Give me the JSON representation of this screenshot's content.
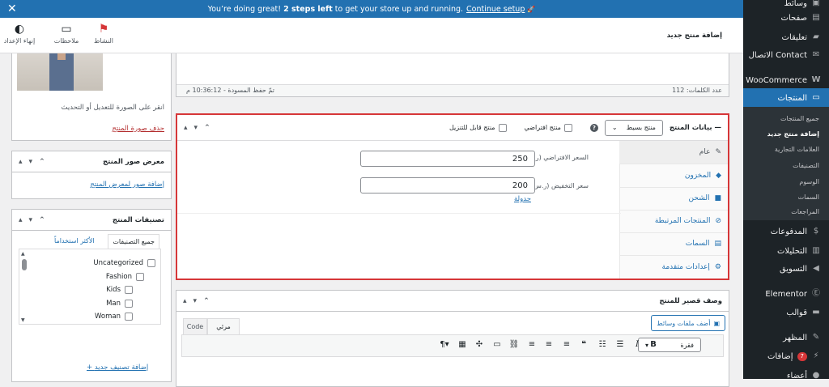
{
  "notice": {
    "text_before": "You’re doing great!",
    "text_bold": "2 steps left",
    "text_after": "to get your store up and running.",
    "link": "Continue setup",
    "rocket": "🚀"
  },
  "header": {
    "title": "إضافة منتج جديد",
    "buttons": [
      {
        "label": "النشاط",
        "icon": "flag-icon"
      },
      {
        "label": "ملاحظات",
        "icon": "inbox-icon"
      },
      {
        "label": "إنهاء الإعداد",
        "icon": "progress-circle-icon"
      }
    ]
  },
  "menu": {
    "items": [
      {
        "label": "وسائط",
        "icon": "media-icon"
      },
      {
        "label": "صفحات",
        "icon": "page-icon"
      },
      {
        "label": "تعليقات",
        "icon": "comment-icon"
      },
      {
        "label": "الاتصال Contact",
        "icon": "mail-icon"
      },
      {
        "label": "WooCommerce",
        "icon": "woo-icon"
      },
      {
        "label": "المنتجات",
        "icon": "archive-icon"
      },
      {
        "label": "المدفوعات",
        "icon": "dollar-icon"
      },
      {
        "label": "التحليلات",
        "icon": "bar-chart-icon"
      },
      {
        "label": "التسويق",
        "icon": "megaphone-icon"
      },
      {
        "label": "Elementor",
        "icon": "elementor-icon"
      },
      {
        "label": "قوالب",
        "icon": "folder-icon"
      },
      {
        "label": "المظهر",
        "icon": "brush-icon"
      },
      {
        "label": "إضافات",
        "icon": "plugin-icon",
        "badge": "7"
      },
      {
        "label": "أعضاء",
        "icon": "users-icon"
      }
    ],
    "submenu": [
      "جميع المنتجات",
      "إضافة منتج جديد",
      "العلامات التجارية",
      "التصنيفات",
      "الوسوم",
      "السمات",
      "المراجعات"
    ]
  },
  "editor_status": {
    "word_count": "عدد الكلمات: 112",
    "draft_saved": "تمّ حفظ المسودة - 10:36:12 م"
  },
  "product_data": {
    "title": "بيانات المنتج —",
    "type_select": "منتج بسيط",
    "help_icon": "?",
    "virtual_label": "منتج افتراضي",
    "downloadable_label": "منتج قابل للتنزيل",
    "tabs": [
      {
        "label": "عام",
        "icon": "wrench-icon"
      },
      {
        "label": "المخزون",
        "icon": "diamond-icon"
      },
      {
        "label": "الشحن",
        "icon": "truck-icon"
      },
      {
        "label": "المنتجات المرتبطة",
        "icon": "link-icon"
      },
      {
        "label": "السمات",
        "icon": "list-icon"
      },
      {
        "label": "إعدادات متقدمة",
        "icon": "gear-icon"
      }
    ],
    "regular_price_label": "السعر الافتراضي (ر.س)",
    "regular_price": "250",
    "sale_price_label": "سعر التخفيض (ر.س)",
    "sale_price": "200",
    "schedule_link": "جدولة"
  },
  "short_description": {
    "title": "وصف قصير للمنتج",
    "add_media": "أضف ملفات وسائط",
    "tab_visual": "مرئي",
    "tab_code": "Code",
    "paragraph_select": "فقرة"
  },
  "product_image": {
    "hint": "انقر على الصورة للتعديل أو التحديث",
    "remove_link": "حذف صورة المنتج"
  },
  "gallery": {
    "title": "معرض صور المنتج",
    "add_link": "إضافة صور لمعرض المنتج"
  },
  "categories": {
    "title": "تصنيفات المنتج",
    "tab_all": "جميع التصنيفات",
    "tab_popular": "الأكثر استخداماً",
    "items": [
      "Uncategorized",
      "Fashion",
      "Kids",
      "Man",
      "Woman"
    ],
    "add_link": "+ إضافة تصنيف جديد"
  },
  "colors": {
    "accent": "#2271b1",
    "sidebar": "#1d2327",
    "highlight_border": "#d63638"
  }
}
